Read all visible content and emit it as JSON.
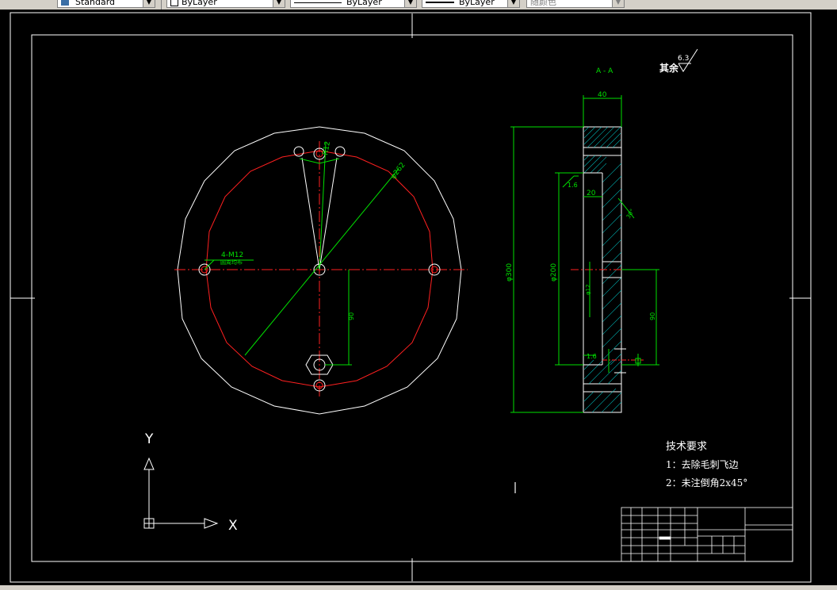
{
  "toolbar": {
    "text_style": "Standard",
    "layer": "ByLayer",
    "linetype": "ByLayer",
    "lineweight": "ByLayer",
    "plot_style": "随颜色"
  },
  "drawing": {
    "section_title": "A - A",
    "surface_note": "其余",
    "roughness_value": "6.3",
    "dims": {
      "thickness": "40",
      "pitch_diameter": "φ262",
      "radius": "R12",
      "holes": "4-M12",
      "holes_note": "圆周均布",
      "center_offset": "90",
      "outer_dia": "φ300",
      "bore_dia": "φ200",
      "step_width": "20",
      "chamfer_a": "1.6",
      "chamfer_b": "1.6",
      "small_dia": "φ12",
      "angle": "30°"
    },
    "tech_req_title": "技术要求",
    "tech_req_1": "1：去除毛刺飞边",
    "tech_req_2": "2：未注倒角2x45°",
    "ucs_y": "Y",
    "ucs_x": "X"
  },
  "colors": {
    "background": "#000000",
    "geometry": "#ffffff",
    "centerline": "#ff0000",
    "dimension": "#00ff00",
    "hatch": "#00ffff",
    "toolbar": "#d4d0c8"
  }
}
